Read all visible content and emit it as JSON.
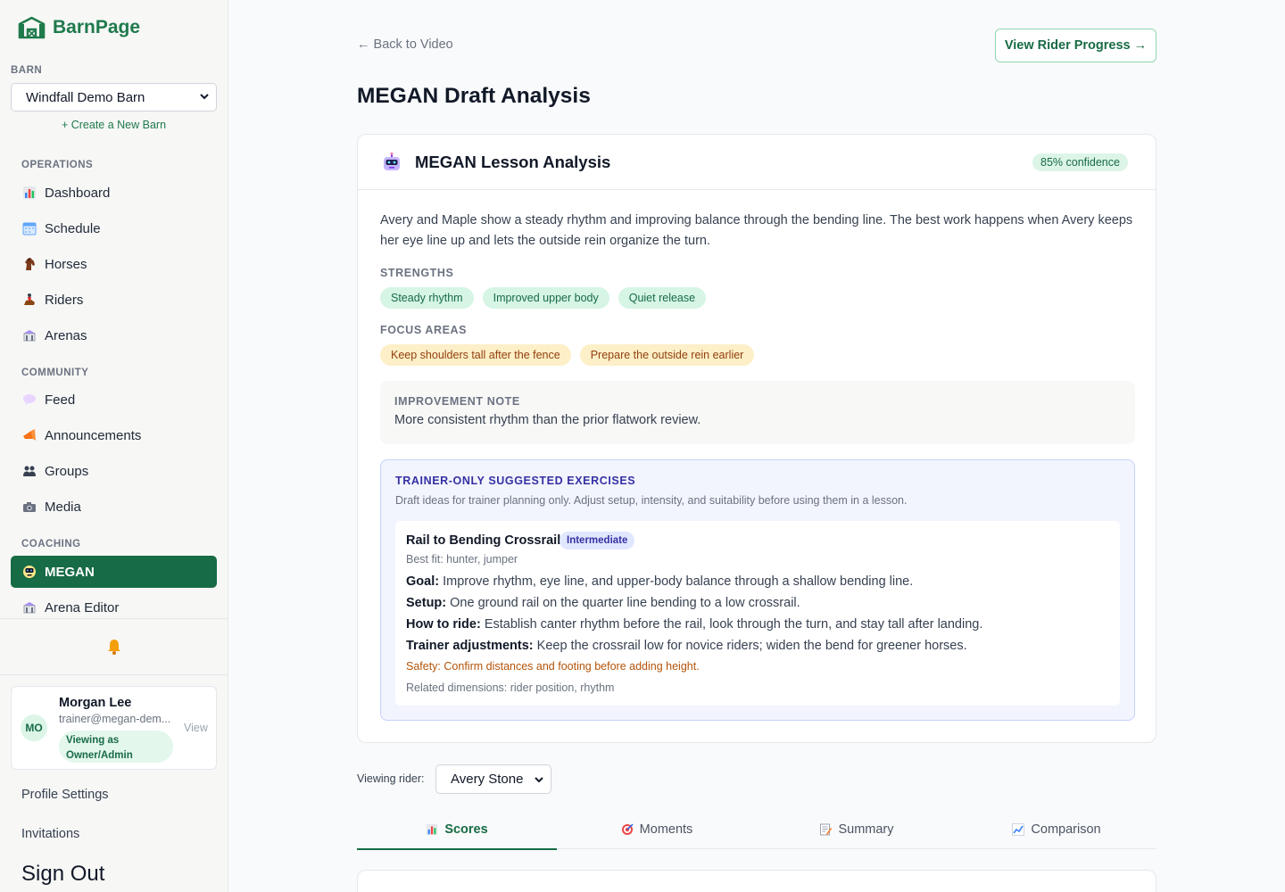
{
  "brand": {
    "name": "BarnPage"
  },
  "sidebar": {
    "barn_label": "BARN",
    "barn_selected": "Windfall Demo Barn",
    "create_barn": "+ Create a New Barn",
    "sections": {
      "operations": "OPERATIONS",
      "community": "COMMUNITY",
      "coaching": "COACHING"
    },
    "items": [
      {
        "label": "Dashboard",
        "icon": "bar-chart-icon"
      },
      {
        "label": "Schedule",
        "icon": "calendar-icon"
      },
      {
        "label": "Horses",
        "icon": "horse-icon"
      },
      {
        "label": "Riders",
        "icon": "rider-icon"
      },
      {
        "label": "Arenas",
        "icon": "arena-icon"
      },
      {
        "label": "Feed",
        "icon": "speech-bubble-icon"
      },
      {
        "label": "Announcements",
        "icon": "megaphone-icon"
      },
      {
        "label": "Groups",
        "icon": "people-icon"
      },
      {
        "label": "Media",
        "icon": "camera-icon"
      },
      {
        "label": "MEGAN",
        "icon": "robot-icon",
        "active": true
      },
      {
        "label": "Arena Editor",
        "icon": "arena-icon"
      }
    ],
    "user": {
      "initials": "MO",
      "name": "Morgan Lee",
      "email": "trainer@megan-dem...",
      "role": "Viewing as Owner/Admin",
      "view": "View"
    },
    "profile_settings": "Profile Settings",
    "invitations": "Invitations",
    "sign_out": "Sign Out"
  },
  "header": {
    "back": "← Back to Video",
    "progress_button": "View Rider Progress →",
    "title": "MEGAN Draft Analysis"
  },
  "analysis": {
    "title": "MEGAN Lesson Analysis",
    "confidence": "85% confidence",
    "summary": "Avery and Maple show a steady rhythm and improving balance through the bending line. The best work happens when Avery keeps her eye line up and lets the outside rein organize the turn.",
    "strengths_label": "STRENGTHS",
    "strengths": [
      "Steady rhythm",
      "Improved upper body",
      "Quiet release"
    ],
    "focus_label": "FOCUS AREAS",
    "focus": [
      "Keep shoulders tall after the fence",
      "Prepare the outside rein earlier"
    ],
    "note_label": "IMPROVEMENT NOTE",
    "note": "More consistent rhythm than the prior flatwork review.",
    "exercises": {
      "label": "TRAINER-ONLY SUGGESTED EXERCISES",
      "description": "Draft ideas for trainer planning only. Adjust setup, intensity, and suitability before using them in a lesson.",
      "item": {
        "name": "Rail to Bending Crossrail",
        "level": "Intermediate",
        "best_fit": "Best fit: hunter, jumper",
        "goal_label": "Goal:",
        "goal": "Improve rhythm, eye line, and upper-body balance through a shallow bending line.",
        "setup_label": "Setup:",
        "setup": "One ground rail on the quarter line bending to a low crossrail.",
        "ride_label": "How to ride:",
        "ride": "Establish canter rhythm before the rail, look through the turn, and stay tall after landing.",
        "adjust_label": "Trainer adjustments:",
        "adjust": "Keep the crossrail low for novice riders; widen the bend for greener horses.",
        "safety": "Safety: Confirm distances and footing before adding height.",
        "related": "Related dimensions: rider position, rhythm"
      }
    }
  },
  "rider_view": {
    "label": "Viewing rider:",
    "selected": "Avery Stone"
  },
  "tabs": [
    {
      "label": "Scores",
      "icon": "bar-chart-icon",
      "active": true
    },
    {
      "label": "Moments",
      "icon": "target-icon"
    },
    {
      "label": "Summary",
      "icon": "memo-icon"
    },
    {
      "label": "Comparison",
      "icon": "trend-chart-icon"
    }
  ],
  "colors": {
    "brand_green": "#176b45",
    "success_bg": "#d6f5e5",
    "amber_bg": "#fdefc7",
    "indigo": "#3730a3"
  }
}
